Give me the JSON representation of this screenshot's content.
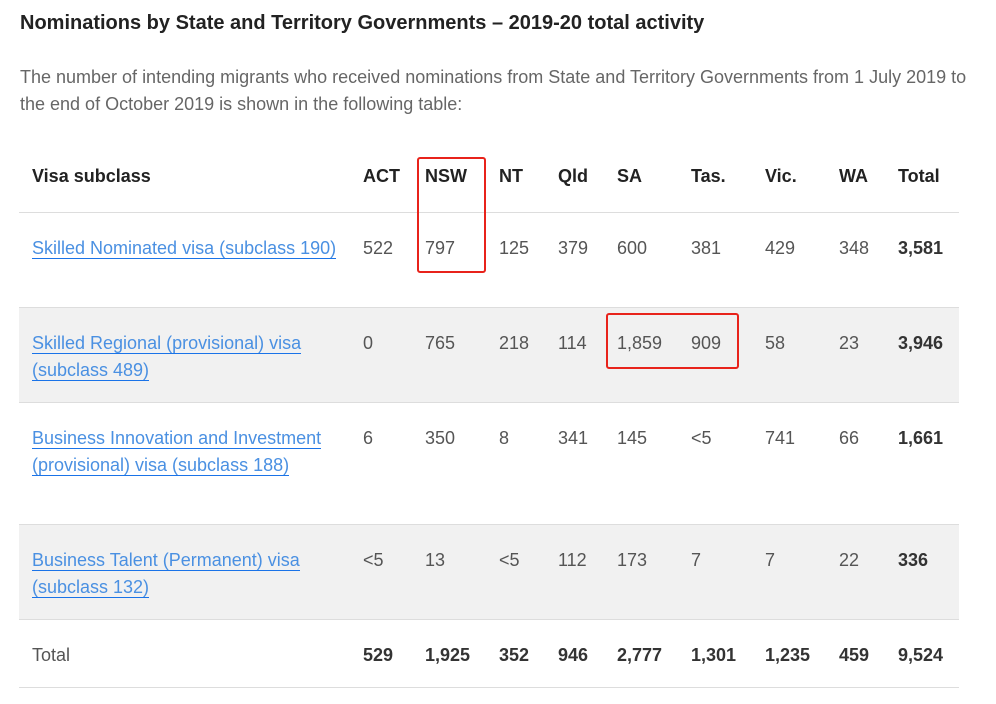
{
  "title": "Nominations by State and Territory Governments – 2019-20 total activity",
  "intro": "The number of intending migrants who received nominations from State and Territory Governments from 1 July 2019 to the end of October 2019 is shown in the following table:",
  "table": {
    "headers": [
      "Visa subclass",
      "ACT",
      "NSW",
      "NT",
      "Qld",
      "SA",
      "Tas.",
      "Vic.",
      "WA",
      "Total"
    ],
    "rows": [
      {
        "label": "Skilled Nominated visa (subclass 190)",
        "values": [
          "522",
          "797",
          "125",
          "379",
          "600",
          "381",
          "429",
          "348"
        ],
        "total": "3,581"
      },
      {
        "label": "Skilled Regional (provisional) visa (subclass 489)",
        "values": [
          "0",
          "765",
          "218",
          "114",
          "1,859",
          "909",
          "58",
          "23"
        ],
        "total": "3,946"
      },
      {
        "label": "Business Innovation and Investment (provisional) visa (subclass 188)",
        "values": [
          "6",
          "350",
          "8",
          "341",
          "145",
          "<5",
          "741",
          "66"
        ],
        "total": "1,661"
      },
      {
        "label": "Business Talent (Permanent) visa (subclass 132)",
        "values": [
          "<5",
          "13",
          "<5",
          "112",
          "173",
          "7",
          "7",
          "22"
        ],
        "total": "336"
      }
    ],
    "total_row": {
      "label": "Total",
      "values": [
        "529",
        "1,925",
        "352",
        "946",
        "2,777",
        "1,301",
        "1,235",
        "459"
      ],
      "total": "9,524"
    }
  },
  "highlight_color": "#e8231b"
}
